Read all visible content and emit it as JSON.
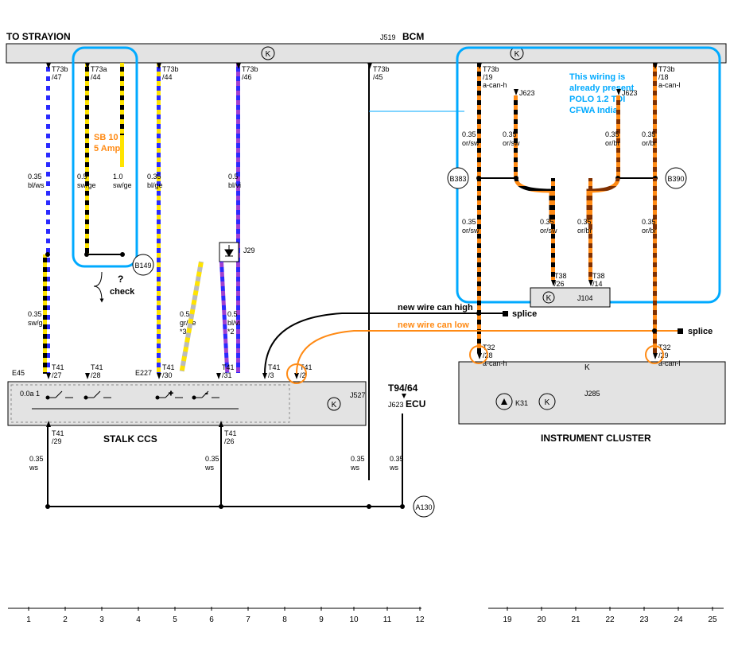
{
  "header": {
    "to": "TO STRAYION",
    "j519": "J519",
    "bcm": "BCM"
  },
  "fuse": {
    "id": "SB 10",
    "rating": "5 Amp",
    "check": "check",
    "qmark": "?",
    "b149": "B149"
  },
  "wires": {
    "w1": {
      "gauge": "0.35",
      "color": "bl/ws"
    },
    "w2": {
      "gauge": "0.5",
      "color": "sw/ge"
    },
    "w3": {
      "gauge": "1.0",
      "color": "sw/ge"
    },
    "w4": {
      "gauge": "0.35",
      "color": "bl/ge"
    },
    "w5": {
      "gauge": "0.5",
      "color": "bl/vi"
    },
    "w6": {
      "gauge": "0.35",
      "color": "sw/ge"
    },
    "w7": {
      "gauge": "0.5",
      "color": "gr/ge",
      "note": "*3"
    },
    "w8": {
      "gauge": "0.5",
      "color": "bl/vi",
      "note": "*2"
    },
    "w9": {
      "gauge": "0.35",
      "color": "ws"
    },
    "w10": {
      "gauge": "0.35",
      "color": "ws"
    },
    "w11": {
      "gauge": "0.35",
      "color": "ws"
    },
    "w12": {
      "gauge": "0.35",
      "color": "ws"
    },
    "canh_top_l": {
      "gauge": "0.35",
      "color": "or/sw"
    },
    "canh_top_r": {
      "gauge": "0.35",
      "color": "or/sw"
    },
    "canh_bot_l": {
      "gauge": "0.35",
      "color": "or/sw"
    },
    "canh_bot_r": {
      "gauge": "0.35",
      "color": "or/sw"
    },
    "canl_top_l": {
      "gauge": "0.35",
      "color": "or/br"
    },
    "canl_top_r": {
      "gauge": "0.35",
      "color": "or/br"
    },
    "canl_bot_l": {
      "gauge": "0.35",
      "color": "or/br"
    },
    "canl_bot_r": {
      "gauge": "0.35",
      "color": "or/br"
    }
  },
  "terms": {
    "t73b47": {
      "conn": "T73b",
      "pin": "/47"
    },
    "t73a44": {
      "conn": "T73a",
      "pin": "/44"
    },
    "t73b44": {
      "conn": "T73b",
      "pin": "/44"
    },
    "t73b46": {
      "conn": "T73b",
      "pin": "/46"
    },
    "t73b45": {
      "conn": "T73b",
      "pin": "/45"
    },
    "t73b19": {
      "conn": "T73b",
      "pin": "/19",
      "sig": "a-can-h"
    },
    "t73b18": {
      "conn": "T73b",
      "pin": "/18",
      "sig": "a-can-l"
    },
    "j623a": "J623",
    "j623b": "J623",
    "t41_27": {
      "conn": "T41",
      "pin": "/27"
    },
    "t41_28": {
      "conn": "T41",
      "pin": "/28"
    },
    "t41_30": {
      "conn": "T41",
      "pin": "/30"
    },
    "t41_31": {
      "conn": "T41",
      "pin": "/31"
    },
    "t41_3": {
      "conn": "T41",
      "pin": "/3"
    },
    "t41_2": {
      "conn": "T41",
      "pin": "/2"
    },
    "t41_29": {
      "conn": "T41",
      "pin": "/29"
    },
    "t41_26": {
      "conn": "T41",
      "pin": "/26"
    },
    "t32_28": {
      "conn": "T32",
      "pin": "/28",
      "sig": "a-can-h"
    },
    "t32_29": {
      "conn": "T32",
      "pin": "/29",
      "sig": "a-can-l"
    },
    "t38_26": {
      "conn": "T38",
      "pin": "/26"
    },
    "t38_14": {
      "conn": "T38",
      "pin": "/14"
    }
  },
  "labels": {
    "e45": "E45",
    "e227": "E227",
    "j29": "J29",
    "j527": "J527",
    "j285": "J285",
    "k": "K",
    "k31": "K31",
    "j104": "J104",
    "b383": "B383",
    "b390": "B390",
    "a130": "A130",
    "stalk": "STALK CCS",
    "inst": "INSTRUMENT CLUSTER",
    "t94": "T94/64",
    "j623ecu": "J623",
    "ecu": "ECU",
    "ooa1": "0.0a 1"
  },
  "annot": {
    "present": "This wiring is\nalready present\nPOLO 1.2 TDI\nCFWA India",
    "newh": "new wire can high",
    "newl": "new wire can low",
    "splice1": "splice",
    "splice2": "splice"
  },
  "ruler": [
    "1",
    "2",
    "3",
    "4",
    "5",
    "6",
    "7",
    "8",
    "9",
    "10",
    "11",
    "12",
    "19",
    "20",
    "21",
    "22",
    "23",
    "24",
    "25"
  ]
}
